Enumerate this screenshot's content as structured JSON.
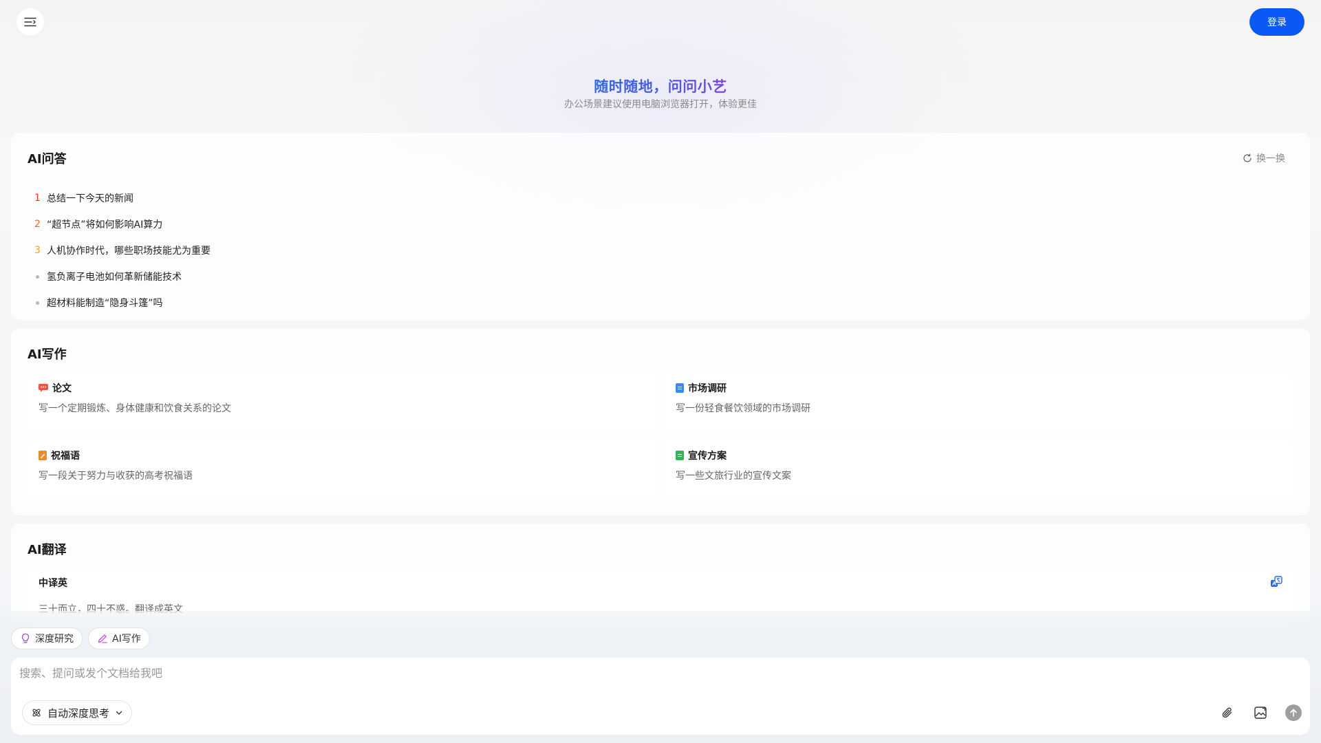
{
  "header": {
    "login_label": "登录"
  },
  "hero": {
    "title": "随时随地，问问小艺",
    "subtitle": "办公场景建议使用电脑浏览器打开，体验更佳"
  },
  "qa": {
    "title": "AI问答",
    "refresh_label": "换一换",
    "items": [
      {
        "rank": "1",
        "text": "总结一下今天的新闻",
        "color": "#e5372c"
      },
      {
        "rank": "2",
        "text": "“超节点”将如何影响AI算力",
        "color": "#f0651f"
      },
      {
        "rank": "3",
        "text": "人机协作时代，哪些职场技能尤为重要",
        "color": "#f2a11b"
      },
      {
        "rank": "",
        "text": "氢负离子电池如何革新储能技术"
      },
      {
        "rank": "",
        "text": "超材料能制造“隐身斗篷”吗"
      }
    ]
  },
  "writing": {
    "title": "AI写作",
    "items": [
      {
        "label": "论文",
        "desc": "写一个定期锻炼、身体健康和饮食关系的论文",
        "icon": "comment-icon",
        "color": "#f0533f"
      },
      {
        "label": "市场调研",
        "desc": "写一份轻食餐饮领域的市场调研",
        "icon": "document-icon",
        "color": "#3b8cf2"
      },
      {
        "label": "祝福语",
        "desc": "写一段关于努力与收获的高考祝福语",
        "icon": "edit-document-icon",
        "color": "#f08a24"
      },
      {
        "label": "宣传方案",
        "desc": "写一些文旅行业的宣传文案",
        "icon": "document-icon",
        "color": "#34b35a"
      }
    ]
  },
  "translate": {
    "title": "AI翻译",
    "mode": "中译英",
    "desc": "三十而立，四十不惑。翻译成英文"
  },
  "chips": {
    "deep_research": "深度研究",
    "ai_writing": "AI写作"
  },
  "input": {
    "placeholder": "搜索、提问或发个文档给我吧",
    "think_mode": "自动深度思考"
  },
  "colors": {
    "accent": "#0a59f7",
    "title_gradient": [
      "#2f66ea",
      "#7a44e0"
    ]
  }
}
